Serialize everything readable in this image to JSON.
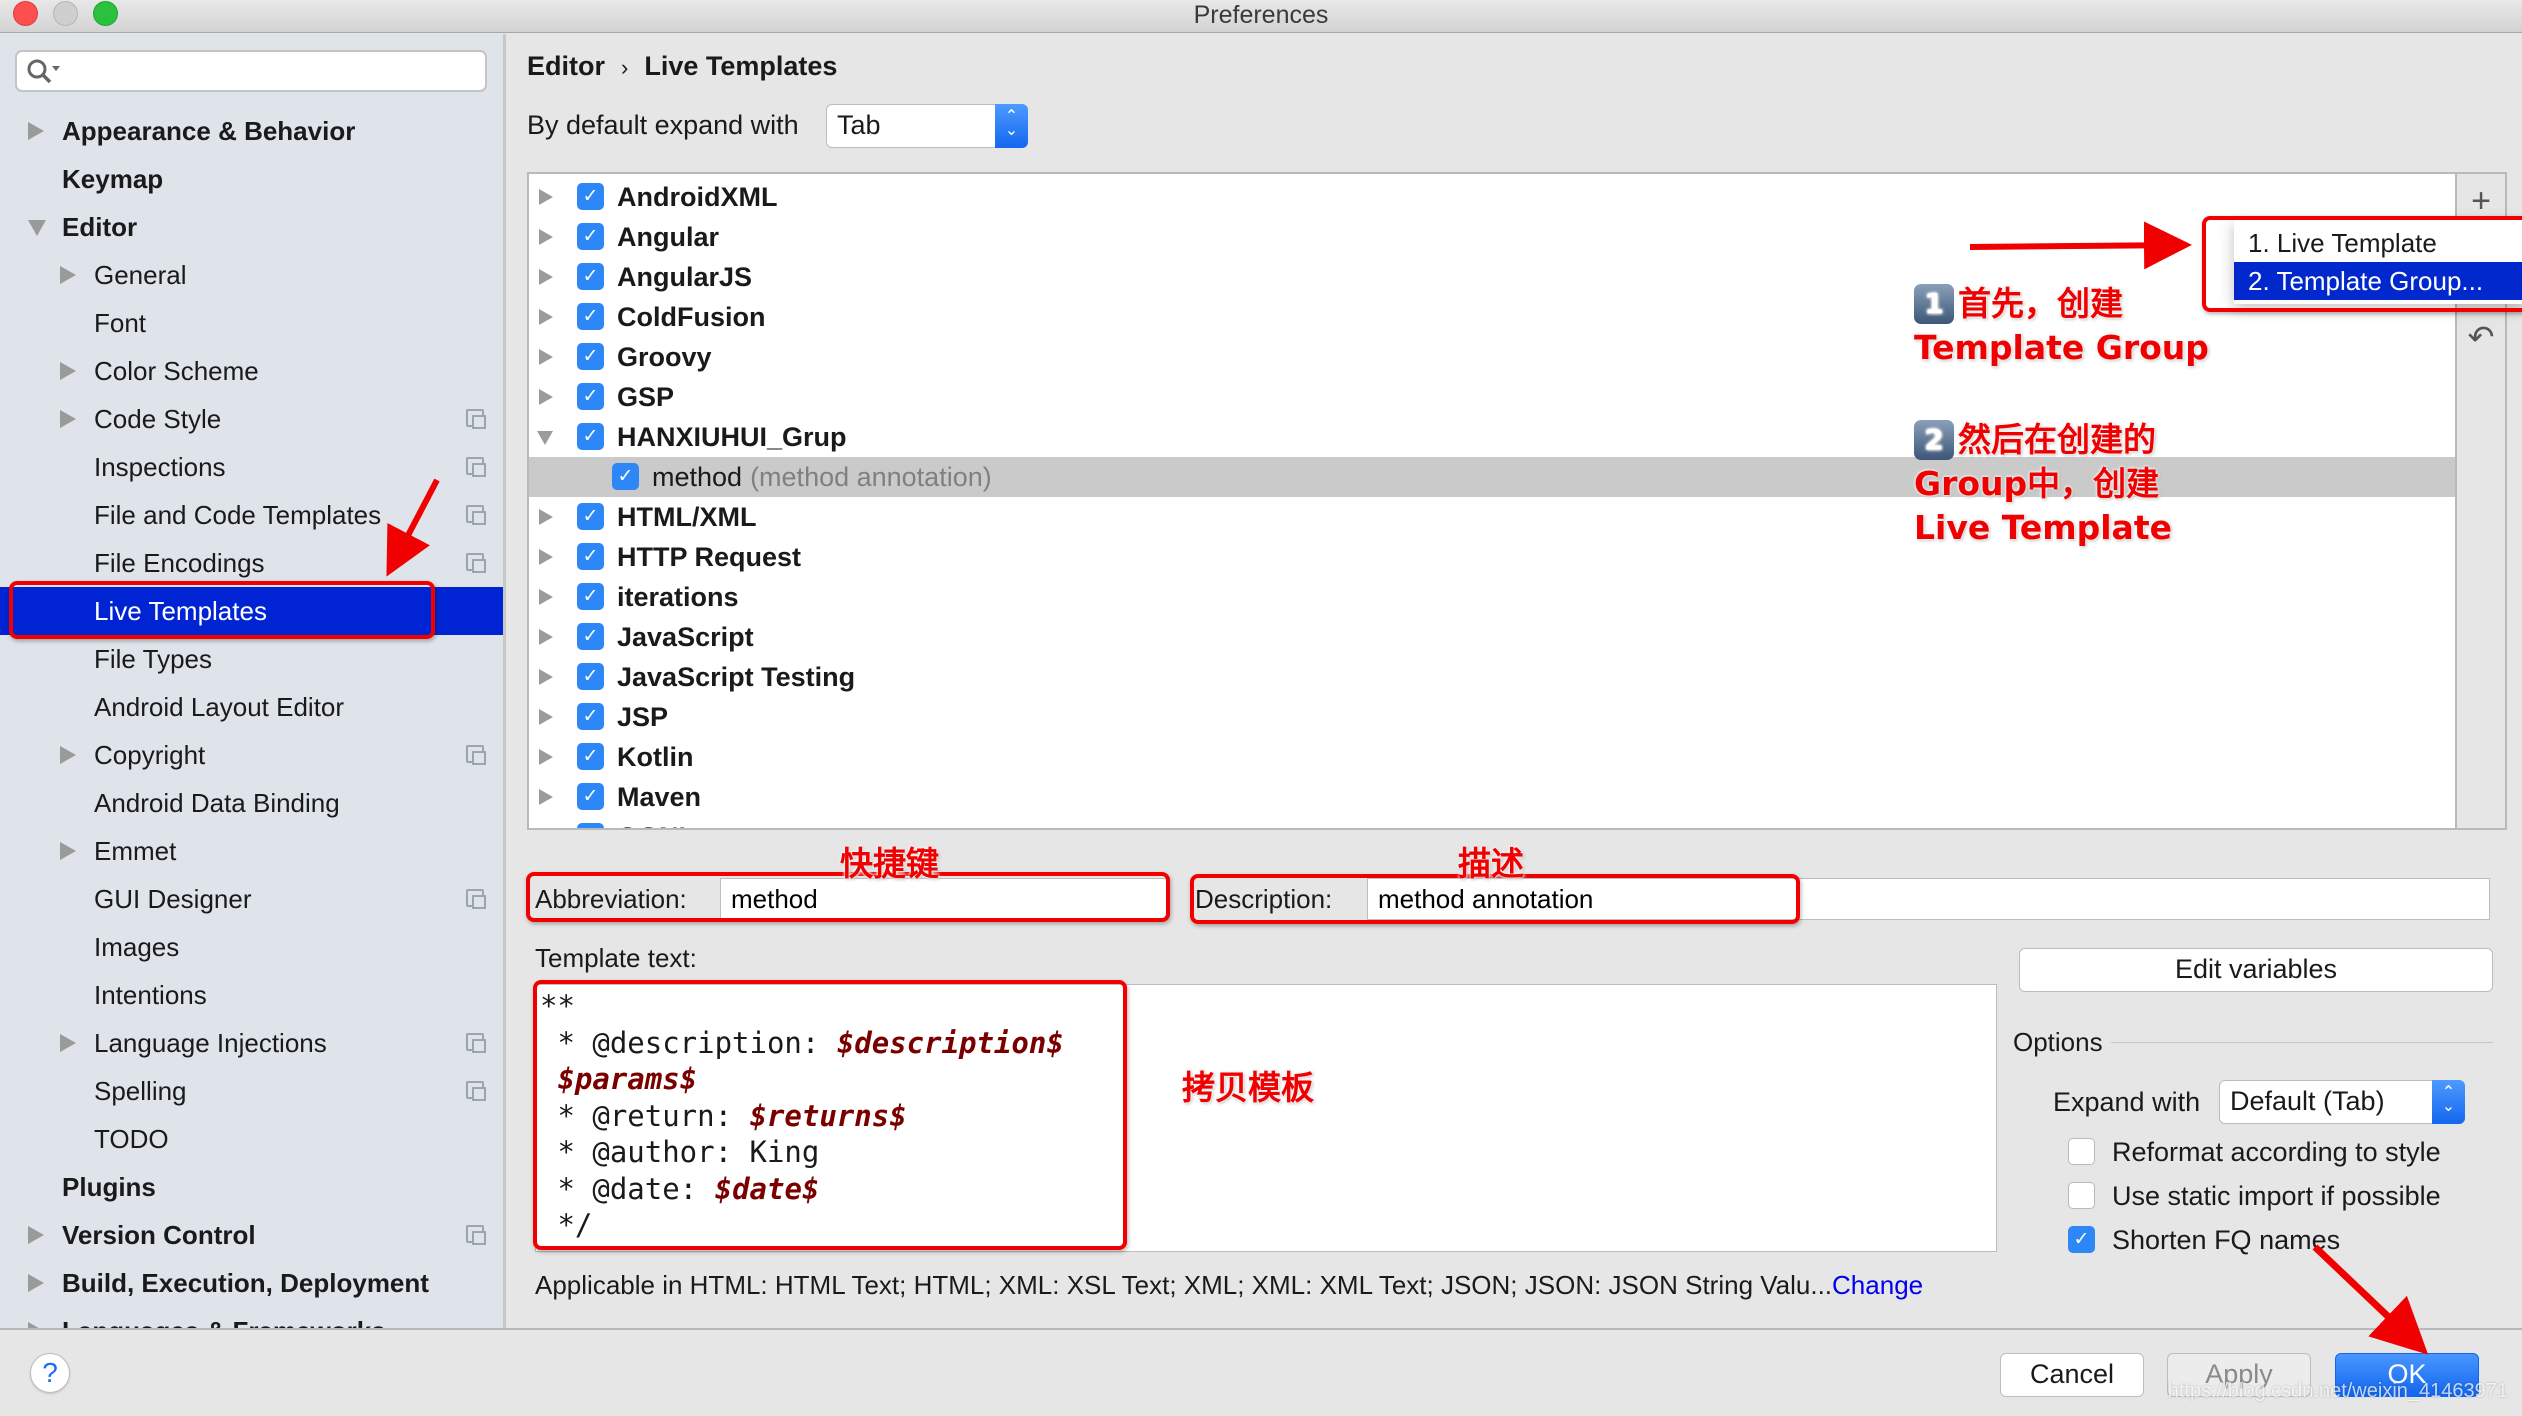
{
  "window": {
    "title": "Preferences",
    "traffic_lights": [
      {
        "name": "close",
        "color": "#fc4f4f"
      },
      {
        "name": "minimize",
        "color": "#cfcfcf"
      },
      {
        "name": "zoom",
        "color": "#29c13e"
      }
    ]
  },
  "sidebar": {
    "search": {
      "value": "",
      "placeholder": "",
      "icon": "search-icon"
    },
    "items": [
      {
        "label": "Appearance & Behavior",
        "level": 0,
        "bold": true,
        "expander": "collapsed",
        "project_icon": false
      },
      {
        "label": "Keymap",
        "level": 0,
        "bold": true,
        "expander": "none",
        "project_icon": false
      },
      {
        "label": "Editor",
        "level": 0,
        "bold": true,
        "expander": "expanded",
        "project_icon": false
      },
      {
        "label": "General",
        "level": 1,
        "bold": false,
        "expander": "collapsed",
        "project_icon": false
      },
      {
        "label": "Font",
        "level": 1,
        "bold": false,
        "expander": "none",
        "project_icon": false
      },
      {
        "label": "Color Scheme",
        "level": 1,
        "bold": false,
        "expander": "collapsed",
        "project_icon": false
      },
      {
        "label": "Code Style",
        "level": 1,
        "bold": false,
        "expander": "collapsed",
        "project_icon": true
      },
      {
        "label": "Inspections",
        "level": 1,
        "bold": false,
        "expander": "none",
        "project_icon": true
      },
      {
        "label": "File and Code Templates",
        "level": 1,
        "bold": false,
        "expander": "none",
        "project_icon": true
      },
      {
        "label": "File Encodings",
        "level": 1,
        "bold": false,
        "expander": "none",
        "project_icon": true
      },
      {
        "label": "Live Templates",
        "level": 1,
        "bold": false,
        "expander": "none",
        "project_icon": false,
        "selected": true
      },
      {
        "label": "File Types",
        "level": 1,
        "bold": false,
        "expander": "none",
        "project_icon": false
      },
      {
        "label": "Android Layout Editor",
        "level": 1,
        "bold": false,
        "expander": "none",
        "project_icon": false
      },
      {
        "label": "Copyright",
        "level": 1,
        "bold": false,
        "expander": "collapsed",
        "project_icon": true
      },
      {
        "label": "Android Data Binding",
        "level": 1,
        "bold": false,
        "expander": "none",
        "project_icon": false
      },
      {
        "label": "Emmet",
        "level": 1,
        "bold": false,
        "expander": "collapsed",
        "project_icon": false
      },
      {
        "label": "GUI Designer",
        "level": 1,
        "bold": false,
        "expander": "none",
        "project_icon": true
      },
      {
        "label": "Images",
        "level": 1,
        "bold": false,
        "expander": "none",
        "project_icon": false
      },
      {
        "label": "Intentions",
        "level": 1,
        "bold": false,
        "expander": "none",
        "project_icon": false
      },
      {
        "label": "Language Injections",
        "level": 1,
        "bold": false,
        "expander": "collapsed",
        "project_icon": true
      },
      {
        "label": "Spelling",
        "level": 1,
        "bold": false,
        "expander": "none",
        "project_icon": true
      },
      {
        "label": "TODO",
        "level": 1,
        "bold": false,
        "expander": "none",
        "project_icon": false
      },
      {
        "label": "Plugins",
        "level": 0,
        "bold": true,
        "expander": "none",
        "project_icon": false
      },
      {
        "label": "Version Control",
        "level": 0,
        "bold": true,
        "expander": "collapsed",
        "project_icon": true
      },
      {
        "label": "Build, Execution, Deployment",
        "level": 0,
        "bold": true,
        "expander": "collapsed",
        "project_icon": false
      },
      {
        "label": "Languages & Frameworks",
        "level": 0,
        "bold": true,
        "expander": "collapsed",
        "project_icon": false
      }
    ]
  },
  "main": {
    "breadcrumb": {
      "parent": "Editor",
      "separator": "›",
      "current": "Live Templates"
    },
    "expand_default": {
      "label": "By default expand with",
      "value": "Tab"
    },
    "tree": {
      "rows": [
        {
          "name": "AndroidXML",
          "checked": true,
          "expander": "collapsed",
          "type": "group"
        },
        {
          "name": "Angular",
          "checked": true,
          "expander": "collapsed",
          "type": "group"
        },
        {
          "name": "AngularJS",
          "checked": true,
          "expander": "collapsed",
          "type": "group"
        },
        {
          "name": "ColdFusion",
          "checked": true,
          "expander": "collapsed",
          "type": "group"
        },
        {
          "name": "Groovy",
          "checked": true,
          "expander": "collapsed",
          "type": "group"
        },
        {
          "name": "GSP",
          "checked": true,
          "expander": "collapsed",
          "type": "group"
        },
        {
          "name": "HANXIUHUI_Grup",
          "checked": true,
          "expander": "expanded",
          "type": "group"
        },
        {
          "name": "method",
          "description": "(method annotation)",
          "checked": true,
          "expander": "none",
          "type": "template",
          "selected": true
        },
        {
          "name": "HTML/XML",
          "checked": true,
          "expander": "collapsed",
          "type": "group"
        },
        {
          "name": "HTTP Request",
          "checked": true,
          "expander": "collapsed",
          "type": "group"
        },
        {
          "name": "iterations",
          "checked": true,
          "expander": "collapsed",
          "type": "group"
        },
        {
          "name": "JavaScript",
          "checked": true,
          "expander": "collapsed",
          "type": "group"
        },
        {
          "name": "JavaScript Testing",
          "checked": true,
          "expander": "collapsed",
          "type": "group"
        },
        {
          "name": "JSP",
          "checked": true,
          "expander": "collapsed",
          "type": "group"
        },
        {
          "name": "Kotlin",
          "checked": true,
          "expander": "collapsed",
          "type": "group"
        },
        {
          "name": "Maven",
          "checked": true,
          "expander": "collapsed",
          "type": "group"
        },
        {
          "name": "OGNL",
          "checked": true,
          "expander": "collapsed",
          "type": "group"
        }
      ],
      "toolbar": [
        {
          "name": "add",
          "glyph": "+",
          "icon": "plus-icon"
        },
        {
          "name": "copy",
          "glyph": "▬",
          "icon": "copy-icon"
        },
        {
          "name": "restore",
          "glyph": "↶",
          "icon": "undo-icon"
        }
      ]
    },
    "add_popup": {
      "items": [
        {
          "label": "1. Live Template",
          "active": false
        },
        {
          "label": "2. Template Group...",
          "active": true
        }
      ]
    },
    "abbreviation": {
      "label": "Abbreviation:",
      "value": "method"
    },
    "description": {
      "label": "Description:",
      "value": "method annotation"
    },
    "template_text": {
      "label": "Template text:",
      "lines": [
        [
          {
            "t": "**",
            "v": false
          }
        ],
        [
          {
            "t": " * @description: ",
            "v": false
          },
          {
            "t": "$description$",
            "v": true
          }
        ],
        [
          {
            "t": " ",
            "v": false
          },
          {
            "t": "$params$",
            "v": true
          }
        ],
        [
          {
            "t": " * @return: ",
            "v": false
          },
          {
            "t": "$returns$",
            "v": true
          }
        ],
        [
          {
            "t": " * @author: King",
            "v": false
          }
        ],
        [
          {
            "t": " * @date: ",
            "v": false
          },
          {
            "t": "$date$",
            "v": true
          }
        ],
        [
          {
            "t": " */",
            "v": false
          }
        ]
      ]
    },
    "edit_variables_label": "Edit variables",
    "options": {
      "label": "Options",
      "expand_with": {
        "label": "Expand with",
        "value": "Default (Tab)"
      },
      "checkboxes": [
        {
          "label": "Reformat according to style",
          "checked": false
        },
        {
          "label": "Use static import if possible",
          "checked": false
        },
        {
          "label": "Shorten FQ names",
          "checked": true
        }
      ]
    },
    "applicable": {
      "text": "Applicable in HTML: HTML Text; HTML; XML: XSL Text; XML; XML: XML Text; JSON; JSON: JSON String Valu...",
      "link": "Change"
    }
  },
  "footer": {
    "help_label": "?",
    "cancel_label": "Cancel",
    "apply_label": "Apply",
    "ok_label": "OK",
    "watermark": "https://blog.csdn.net/weixin_41463971"
  },
  "annotations": {
    "color": "#f00000",
    "step1": {
      "badge": "1",
      "line1": "首先，创建",
      "line2": "Template Group"
    },
    "step2": {
      "badge": "2",
      "line1": "然后在创建的",
      "line2": "Group中，创建",
      "line3": "Live Template"
    },
    "shortcut_key": "快捷键",
    "description_note": "描述",
    "copy_template": "拷贝模板"
  },
  "colors": {
    "selection_blue": "#0024d4",
    "checkbox_blue": "#2d87f7",
    "template_variable": "#7a0000",
    "link_blue": "#0000ee",
    "sidebar_bg": "#dfe3ea",
    "panel_bg": "#e6e6e6"
  }
}
